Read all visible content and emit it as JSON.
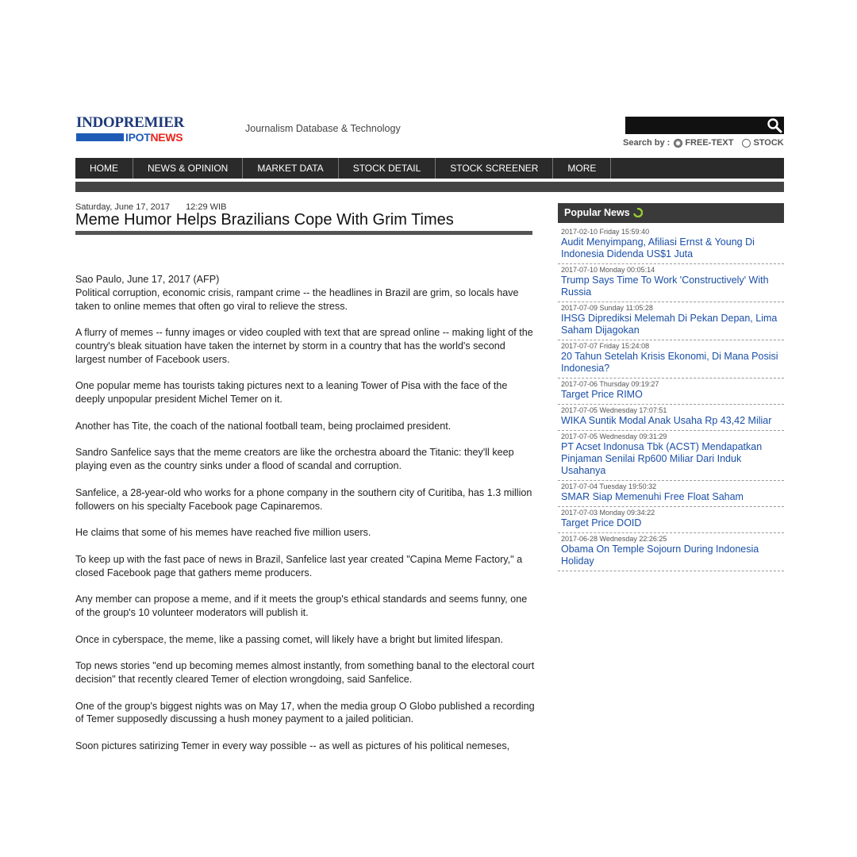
{
  "header": {
    "logo_top": "INDOPREMIER",
    "logo_ipot": "IPOT",
    "logo_news": "NEWS",
    "tagline": "Journalism Database & Technology",
    "search": {
      "placeholder": "",
      "search_by_label": "Search by :",
      "options": [
        "FREE-TEXT",
        "STOCK"
      ],
      "selected": "FREE-TEXT"
    }
  },
  "nav": {
    "items": [
      "HOME",
      "NEWS & OPINION",
      "MARKET DATA",
      "STOCK DETAIL",
      "STOCK SCREENER",
      "MORE"
    ]
  },
  "article": {
    "date": "Saturday, June 17, 2017",
    "time": "12:29 WIB",
    "headline": "Meme Humor Helps Brazilians Cope With Grim Times",
    "paragraphs": [
      "Sao Paulo, June 17, 2017 (AFP)\nPolitical corruption, economic crisis, rampant crime -- the headlines in Brazil are grim, so locals have taken to online memes that often go viral to relieve the stress.",
      "A flurry of memes -- funny images or video coupled with text that are spread online -- making light of the country's bleak situation have taken the internet by storm in a country that has the world's second largest number of Facebook users.",
      "One popular meme has tourists taking pictures next to a leaning Tower of Pisa with the face of the deeply unpopular president Michel Temer on it.",
      "Another has Tite, the coach of the national football team, being proclaimed president.",
      "Sandro Sanfelice says that the meme creators are like the orchestra aboard the Titanic: they'll keep playing even as the country sinks under a flood of scandal and corruption.",
      "Sanfelice, a 28-year-old who works for a phone company in the southern city of Curitiba, has 1.3 million followers on his specialty Facebook page Capinaremos.",
      "He claims that some of his memes have reached five million users.",
      "To keep up with the fast pace of news in Brazil, Sanfelice last year created \"Capina Meme Factory,\" a closed Facebook page that gathers meme producers.",
      "Any member can propose a meme, and if it meets the group's ethical standards and seems funny, one of the group's 10 volunteer moderators will publish it.",
      "Once in cyberspace, the meme, like a passing comet, will likely have a bright but limited lifespan.",
      "Top news stories \"end up becoming memes almost instantly, from something banal to the electoral court decision\" that recently cleared Temer of election wrongdoing, said Sanfelice.",
      "One of the group's biggest nights was on May 17, when the media group O Globo published a recording of Temer supposedly discussing a hush money payment to a jailed politician.",
      "Soon pictures satirizing Temer in every way possible -- as well as pictures of his political nemeses,"
    ]
  },
  "popular": {
    "title": "Popular News",
    "items": [
      {
        "meta": "2017-02-10 Friday 15:59:40",
        "title": "Audit Menyimpang, Afiliasi Ernst & Young Di Indonesia Didenda US$1 Juta"
      },
      {
        "meta": "2017-07-10 Monday 00:05:14",
        "title": "Trump Says Time To Work 'Constructively' With Russia"
      },
      {
        "meta": "2017-07-09 Sunday 11:05:28",
        "title": "IHSG Diprediksi Melemah Di Pekan Depan, Lima Saham Dijagokan"
      },
      {
        "meta": "2017-07-07 Friday 15:24:08",
        "title": "20 Tahun Setelah Krisis Ekonomi, Di Mana Posisi Indonesia?"
      },
      {
        "meta": "2017-07-06 Thursday 09:19:27",
        "title": "Target Price RIMO"
      },
      {
        "meta": "2017-07-05 Wednesday 17:07:51",
        "title": "WIKA Suntik Modal Anak Usaha Rp 43,42 Miliar"
      },
      {
        "meta": "2017-07-05 Wednesday 09:31:29",
        "title": "PT Acset Indonusa Tbk (ACST) Mendapatkan Pinjaman Senilai Rp600 Miliar Dari Induk Usahanya"
      },
      {
        "meta": "2017-07-04 Tuesday 19:50:32",
        "title": "SMAR Siap Memenuhi Free Float Saham"
      },
      {
        "meta": "2017-07-03 Monday 09:34:22",
        "title": "Target Price DOID"
      },
      {
        "meta": "2017-06-28 Wednesday 22:26:25",
        "title": "Obama On Temple Sojourn During Indonesia Holiday"
      }
    ]
  },
  "colors": {
    "nav_bg": "#2a2a2a",
    "link": "#1a4fa8",
    "logo_blue": "#1d3a78",
    "logo_red": "#e8251c"
  }
}
